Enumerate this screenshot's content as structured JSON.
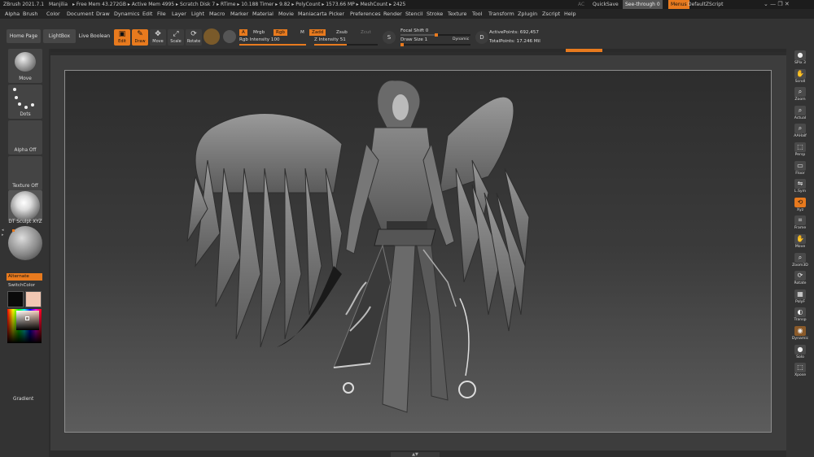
{
  "titlebar": {
    "app": "ZBrush 2021.7.1",
    "user": "Manjilia",
    "stats": "▸ Free Mem 43.272GB ▸ Active Mem 4995 ▸ Scratch Disk 7 ▸  RTime ▸ 10.188 Timer ▸ 9.82 ▸ PolyCount ▸ 1573.66 MP ▸ MeshCount ▸ 2425",
    "ac": "AC",
    "quicksave": "QuickSave",
    "see_through": "See-through  0",
    "menus": "Menus",
    "script": "DefaultZScript",
    "win_controls": "⌄   —   ❐   ✕"
  },
  "menus": [
    "Alpha",
    "Brush",
    "Color",
    "Document",
    "Draw",
    "Dynamics",
    "Edit",
    "File",
    "Layer",
    "Light",
    "Macro",
    "Marker",
    "Material",
    "Movie",
    "Maniacarta",
    "Picker",
    "Preferences",
    "Render",
    "Stencil",
    "Stroke",
    "Texture",
    "Tool",
    "Transform",
    "Zplugin",
    "Zscript",
    "Help"
  ],
  "shelf": {
    "home_page": "Home Page",
    "lightbox": "LightBox",
    "live_boolean": "Live Boolean",
    "tools": [
      {
        "label": "Edit",
        "icon": "▣",
        "active": true
      },
      {
        "label": "Draw",
        "icon": "✎",
        "active": true
      },
      {
        "label": "Move",
        "icon": "✥",
        "active": false
      },
      {
        "label": "Scale",
        "icon": "⤢",
        "active": false
      },
      {
        "label": "Rotate",
        "icon": "⟳",
        "active": false
      }
    ],
    "a_chip": "A",
    "mrgb": "Mrgb",
    "rgb": "Rgb",
    "m": "M",
    "zadd": "Zadd",
    "zsub": "Zsub",
    "zcut": "Zcut",
    "rgb_intensity": "Rgb Intensity 100",
    "rgb_intensity_value": 1.0,
    "z_intensity": "Z Intensity 51",
    "z_intensity_value": 0.51,
    "focal_shift": "Focal Shift 0",
    "draw_size": "Draw Size 1",
    "dynamic": "Dynamic",
    "active_points": "ActivePoints: 692,457",
    "total_points": "TotalPoints: 17.246 Mil",
    "s_label": "S",
    "d_label": "D"
  },
  "left": {
    "move": "Move",
    "dots": "Dots",
    "alpha_off": "Alpha Off",
    "texture_off": "Texture Off",
    "material": "DT Sculpt XYZ",
    "alternate": "Alternate",
    "switch_color": "SwitchColor",
    "gradient": "Gradient",
    "main_color": "#0a0a0a",
    "secondary_color": "#f2c7b3"
  },
  "right": [
    {
      "label": "SPix 3",
      "icon": "●"
    },
    {
      "label": "Scroll",
      "icon": "✋"
    },
    {
      "label": "Zoom",
      "icon": "⌕"
    },
    {
      "label": "Actual",
      "icon": "⌕"
    },
    {
      "label": "AAHalf",
      "icon": "⌕"
    },
    {
      "label": "Persp",
      "icon": "⬚"
    },
    {
      "label": "Floor",
      "icon": "▭"
    },
    {
      "label": "L.Sym",
      "icon": "⇋"
    },
    {
      "label": "Xyz",
      "icon": "⟲"
    },
    {
      "label": "Frame",
      "icon": "⌗"
    },
    {
      "label": "Move",
      "icon": "✋"
    },
    {
      "label": "Zoom3D",
      "icon": "⌕"
    },
    {
      "label": "Rotate",
      "icon": "⟳"
    },
    {
      "label": "PolyF",
      "icon": "▦"
    },
    {
      "label": "Transp",
      "icon": "◐"
    },
    {
      "label": "Dynamic",
      "icon": "◉"
    },
    {
      "label": "Solo",
      "icon": "●"
    },
    {
      "label": "Xpose",
      "icon": "⬚"
    }
  ],
  "progress_value": 0.5,
  "bottom_handle": "▲▼"
}
